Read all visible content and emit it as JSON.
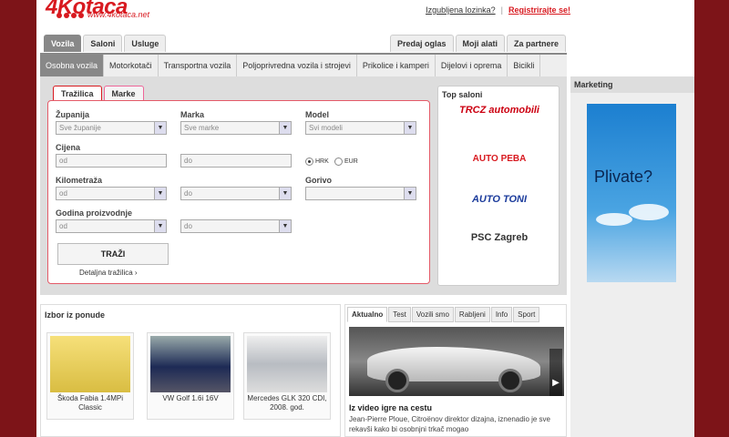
{
  "logo": {
    "text": "4Kotaca",
    "url": "www.4kotaca.net"
  },
  "top_links": {
    "forgot": "Izgubljena lozinka?",
    "register": "Registrirajte se!"
  },
  "main_tabs": [
    "Vozila",
    "Saloni",
    "Usluge"
  ],
  "right_tabs": [
    "Predaj oglas",
    "Moji alati",
    "Za partnere"
  ],
  "sub_nav": [
    "Osobna vozila",
    "Motorkotači",
    "Transportna vozila",
    "Poljoprivredna vozila i strojevi",
    "Prikolice i kamperi",
    "Dijelovi i oprema",
    "Bicikli"
  ],
  "search": {
    "tabs": [
      "Tražilica",
      "Marke"
    ],
    "county_label": "Županija",
    "county_value": "Sve županije",
    "brand_label": "Marka",
    "brand_value": "Sve marke",
    "model_label": "Model",
    "model_value": "Svi modeli",
    "price_label": "Cijena",
    "from": "od",
    "to": "do",
    "currency_hrk": "HRK",
    "currency_eur": "EUR",
    "km_label": "Kilometraža",
    "fuel_label": "Gorivo",
    "year_label": "Godina proizvodnje",
    "search_button": "TRAŽI",
    "advanced_link": "Detaljna tražilica ›"
  },
  "top_saloni": {
    "title": "Top saloni",
    "brands": [
      "TRCZ automobili",
      "AUTO PEBA",
      "AUTO TONI",
      "PSC Zagreb"
    ]
  },
  "marketing": {
    "title": "Marketing",
    "ad_text": "Plivate?"
  },
  "izbor": {
    "title": "Izbor iz ponude",
    "cards": [
      {
        "caption": "Škoda Fabia 1.4MPi Classic"
      },
      {
        "caption": "VW Golf 1.6i 16V"
      },
      {
        "caption": "Mercedes GLK 320 CDI, 2008. god."
      }
    ]
  },
  "news": {
    "tabs": [
      "Aktualno",
      "Test",
      "Vozili smo",
      "Rabljeni",
      "Info",
      "Sport"
    ],
    "title": "Iz video igre na cestu",
    "text": "Jean-Pierre Ploue, Citroënov direktor dizajna, iznenadio je sve rekavši kako bi osobnjni trkač mogao"
  },
  "colors": {
    "brand_red": "#d81a20",
    "background": "#7d1418"
  }
}
